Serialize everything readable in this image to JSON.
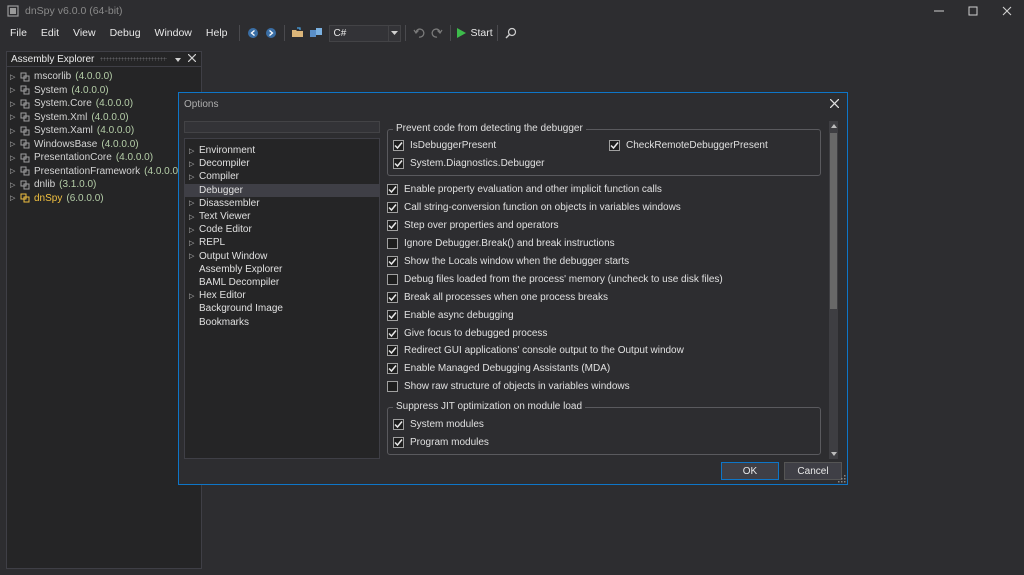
{
  "window": {
    "title": "dnSpy v6.0.0 (64-bit)"
  },
  "menu": [
    "File",
    "Edit",
    "View",
    "Debug",
    "Window",
    "Help"
  ],
  "toolbar": {
    "language": "C#",
    "start_label": "Start"
  },
  "explorer": {
    "title": "Assembly Explorer",
    "items": [
      {
        "name": "mscorlib",
        "version": "(4.0.0.0)"
      },
      {
        "name": "System",
        "version": "(4.0.0.0)"
      },
      {
        "name": "System.Core",
        "version": "(4.0.0.0)"
      },
      {
        "name": "System.Xml",
        "version": "(4.0.0.0)"
      },
      {
        "name": "System.Xaml",
        "version": "(4.0.0.0)"
      },
      {
        "name": "WindowsBase",
        "version": "(4.0.0.0)"
      },
      {
        "name": "PresentationCore",
        "version": "(4.0.0.0)"
      },
      {
        "name": "PresentationFramework",
        "version": "(4.0.0.0)"
      },
      {
        "name": "dnlib",
        "version": "(3.1.0.0)"
      },
      {
        "name": "dnSpy",
        "version": "(6.0.0.0)"
      }
    ]
  },
  "dialog": {
    "title": "Options",
    "nav": [
      {
        "label": "Environment",
        "expandable": true
      },
      {
        "label": "Decompiler",
        "expandable": true
      },
      {
        "label": "Compiler",
        "expandable": true
      },
      {
        "label": "Debugger",
        "expandable": false,
        "selected": true
      },
      {
        "label": "Disassembler",
        "expandable": true
      },
      {
        "label": "Text Viewer",
        "expandable": true
      },
      {
        "label": "Code Editor",
        "expandable": true
      },
      {
        "label": "REPL",
        "expandable": true
      },
      {
        "label": "Output Window",
        "expandable": true
      },
      {
        "label": "Assembly Explorer",
        "expandable": false
      },
      {
        "label": "BAML Decompiler",
        "expandable": false
      },
      {
        "label": "Hex Editor",
        "expandable": true
      },
      {
        "label": "Background Image",
        "expandable": false
      },
      {
        "label": "Bookmarks",
        "expandable": false
      }
    ],
    "prevent_group": {
      "title": "Prevent code from detecting the debugger",
      "items": [
        {
          "label": "IsDebuggerPresent",
          "checked": true
        },
        {
          "label": "CheckRemoteDebuggerPresent",
          "checked": true
        },
        {
          "label": "System.Diagnostics.Debugger",
          "checked": true
        }
      ]
    },
    "options": [
      {
        "label": "Enable property evaluation and other implicit function calls",
        "checked": true
      },
      {
        "label": "Call string-conversion function on objects in variables windows",
        "checked": true
      },
      {
        "label": "Step over properties and operators",
        "checked": true
      },
      {
        "label": "Ignore Debugger.Break() and break instructions",
        "checked": false
      },
      {
        "label": "Show the Locals window when the debugger starts",
        "checked": true
      },
      {
        "label": "Debug files loaded from the process' memory (uncheck to use disk files)",
        "checked": false
      },
      {
        "label": "Break all processes when one process breaks",
        "checked": true
      },
      {
        "label": "Enable async debugging",
        "checked": true
      },
      {
        "label": "Give focus to debugged process",
        "checked": true
      },
      {
        "label": "Redirect GUI applications' console output to the Output window",
        "checked": true
      },
      {
        "label": "Enable Managed Debugging Assistants (MDA)",
        "checked": true
      },
      {
        "label": "Show raw structure of objects in variables windows",
        "checked": false
      }
    ],
    "jit_group": {
      "title": "Suppress JIT optimization on module load",
      "items": [
        {
          "label": "System modules",
          "checked": true
        },
        {
          "label": "Program modules",
          "checked": true
        }
      ]
    },
    "ok_label": "OK",
    "cancel_label": "Cancel"
  },
  "colors": {
    "accent": "#0e76c8",
    "background": "#2d2d30",
    "version_text": "#b5cea8",
    "active_assembly": "#f0c040"
  }
}
